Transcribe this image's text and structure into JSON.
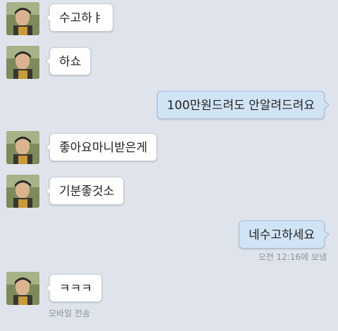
{
  "messages": [
    {
      "side": "in",
      "text": "수고하ㅑ"
    },
    {
      "side": "in",
      "text": "하쇼"
    },
    {
      "side": "out",
      "text": "100만원드려도 안알려드려요"
    },
    {
      "side": "in",
      "text": "좋아요마니받은게"
    },
    {
      "side": "in",
      "text": "기분좋것소"
    },
    {
      "side": "out",
      "text": "네수고하세요",
      "status": "오전 12:16에 보냄"
    },
    {
      "side": "in",
      "text": "ㅋㅋㅋ",
      "status": "모바일 전송"
    }
  ],
  "colors": {
    "background": "#dfe4ec",
    "incoming_bubble": "#ffffff",
    "outgoing_bubble": "#d1e4f5",
    "status_text": "#8c939c"
  },
  "icons": {
    "avatar": "contact-avatar-photo"
  }
}
